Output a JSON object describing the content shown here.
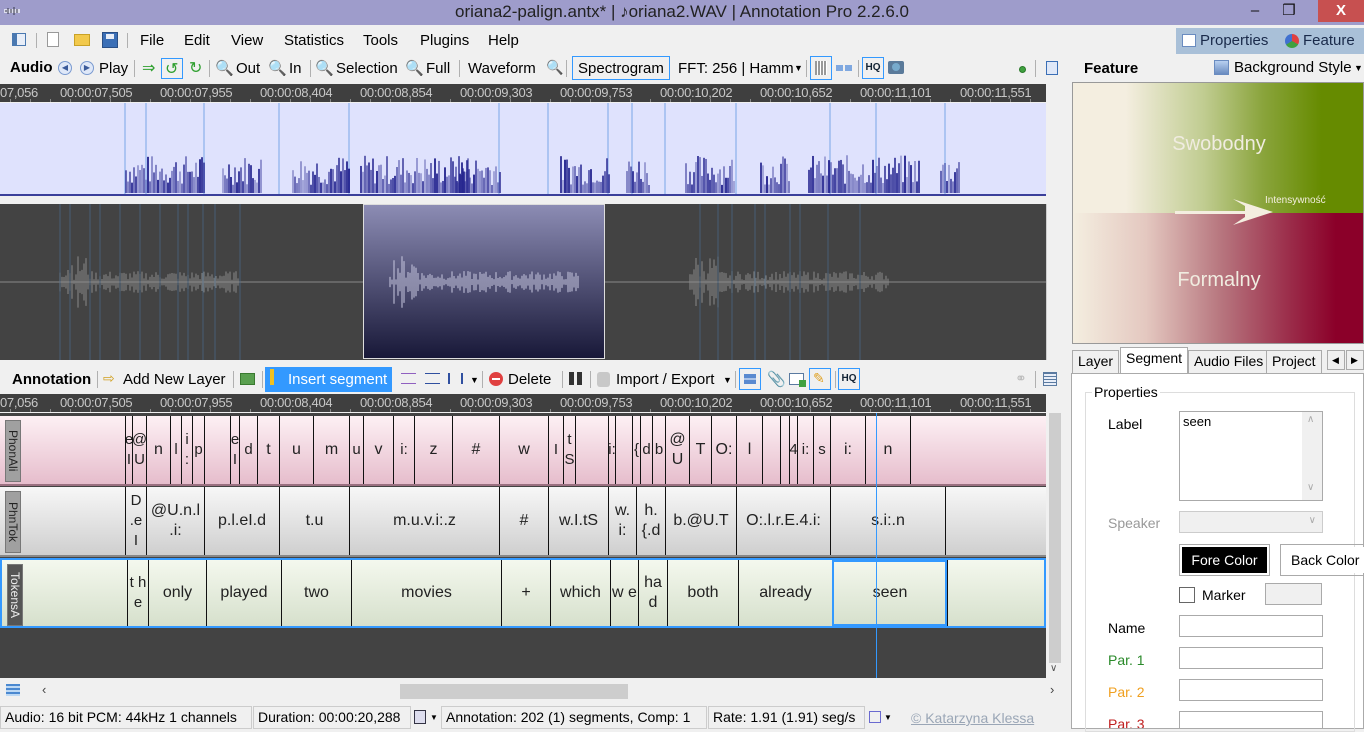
{
  "window": {
    "title": "oriana2-palign.antx* | ♪oriana2.WAV | Annotation Pro 2.2.6.0",
    "minimize": "–",
    "maximize": "❒",
    "close": "X"
  },
  "menu": {
    "items": [
      "File",
      "Edit",
      "View",
      "Statistics",
      "Tools",
      "Plugins",
      "Help"
    ]
  },
  "right_tabs": {
    "properties": "Properties",
    "feature": "Feature"
  },
  "audio_toolbar": {
    "title": "Audio",
    "play": "Play",
    "zoom_out": "Out",
    "zoom_in": "In",
    "selection": "Selection",
    "full": "Full",
    "waveform": "Waveform",
    "spectrogram": "Spectrogram",
    "fft": "FFT: 256 | Hamm",
    "hq": "HQ"
  },
  "feature_toolbar": {
    "title": "Feature",
    "background_style": "Background Style"
  },
  "feature_chart": {
    "top_label": "Swobodny",
    "bottom_label": "Formalny",
    "arrow_label": "Intensywność",
    "top_color": "#668b00",
    "bottom_color": "#8b0029"
  },
  "time_ruler": [
    "07,056",
    "00:00:07,505",
    "00:00:07,955",
    "00:00:08,404",
    "00:00:08,854",
    "00:00:09,303",
    "00:00:09,753",
    "00:00:10,202",
    "00:00:10,652",
    "00:00:11,101",
    "00:00:11,551"
  ],
  "annotation_toolbar": {
    "title": "Annotation",
    "add_layer": "Add New Layer",
    "insert_segment": "Insert segment",
    "delete": "Delete",
    "import_export": "Import / Export",
    "hq": "HQ"
  },
  "layers": [
    {
      "name": "PhonAli",
      "segments": [
        "",
        "e I",
        "@ U",
        "n",
        "l",
        "i :",
        "p",
        "",
        "e I",
        "d",
        "t",
        "u",
        "m",
        "u",
        "v",
        "i:",
        "z",
        "#",
        "w",
        "I",
        "tS",
        "",
        "i:",
        "",
        "{",
        "d",
        "b",
        "@ U",
        "T",
        "O:",
        "l",
        "",
        "",
        "4",
        "i:",
        "s",
        "i:",
        "n",
        ""
      ]
    },
    {
      "name": "PhnTok",
      "segments": [
        "",
        "D .e I",
        "@U.n.l .i:",
        "p.l.eI.d",
        "t.u",
        "m.u.v.i:.z",
        "#",
        "w.I.tS",
        "w. i:",
        "h. {.d",
        "b.@U.T",
        "O:.l.r.E.4.i:",
        "s.i:.n",
        ""
      ]
    },
    {
      "name": "TokensA",
      "segments": [
        "",
        "t h e",
        "only",
        "played",
        "two",
        "movies",
        "+",
        "which",
        "w e",
        "ha d",
        "both",
        "already",
        "seen",
        ""
      ]
    }
  ],
  "statusbar": {
    "audio": "Audio: 16 bit PCM: 44kHz 1 channels",
    "duration": "Duration: 00:00:20,288",
    "annotation": "Annotation: 202 (1) segments, Comp: 1",
    "rate": "Rate: 1.91 (1.91) seg/s",
    "copyright": "©  Katarzyna Klessa"
  },
  "properties_panel": {
    "tabs": [
      "Layer",
      "Segment",
      "Audio Files",
      "Project"
    ],
    "active_tab": "Segment",
    "group_title": "Properties",
    "label_caption": "Label",
    "label_value": "seen",
    "speaker_caption": "Speaker",
    "fore_color": "Fore Color",
    "back_color": "Back Color",
    "marker": "Marker",
    "name_caption": "Name",
    "par1": "Par. 1",
    "par2": "Par. 2",
    "par3": "Par. 3",
    "par1_color": "#2a8a2a",
    "par2_color": "#f0a020",
    "par3_color": "#c02020"
  }
}
